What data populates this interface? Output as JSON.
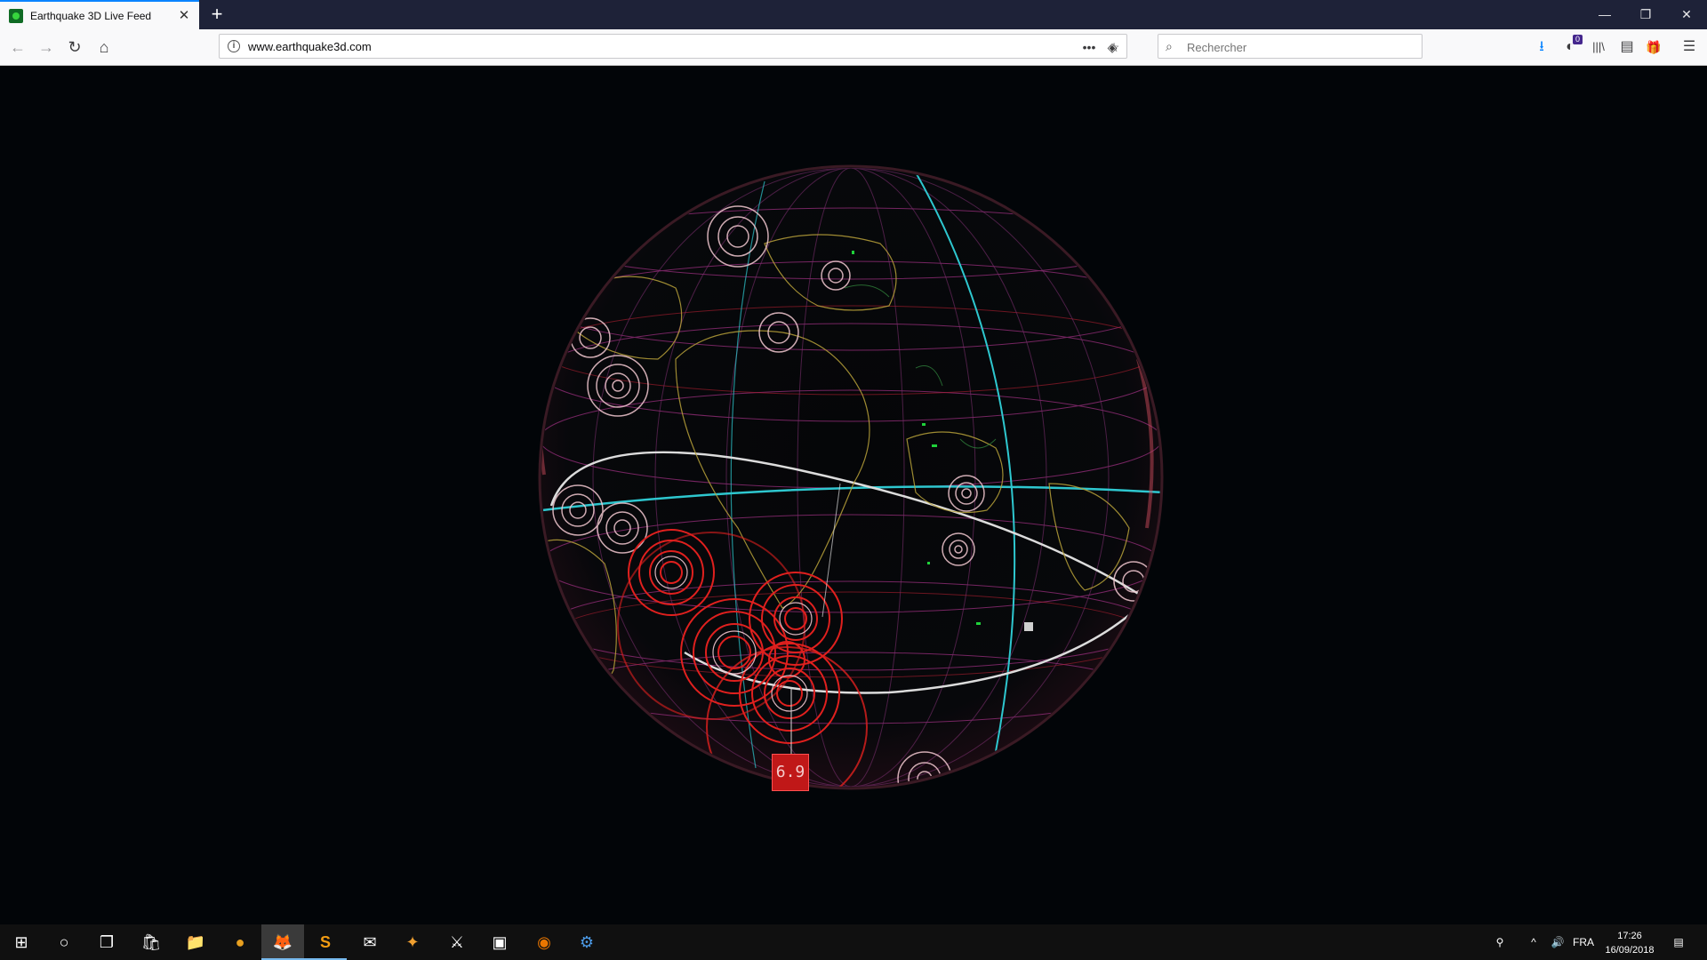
{
  "browser": {
    "tab": {
      "title": "Earthquake 3D Live Feed",
      "favicon": "earth-icon",
      "close_glyph": "✕"
    },
    "new_tab_glyph": "+",
    "window_controls": {
      "minimize": "—",
      "restore": "❐",
      "close": "✕"
    },
    "nav": {
      "back": "←",
      "forward": "→",
      "reload": "↻",
      "home": "⌂"
    },
    "address": {
      "url": "www.earthquake3d.com",
      "info_glyph": "i",
      "page_actions": "•••",
      "pocket": "◈",
      "bookmark": "☆"
    },
    "search": {
      "placeholder": "Rechercher",
      "icon": "⌕"
    },
    "toolbar": {
      "download": "⭳",
      "extension_badge": "0",
      "extension": "◐",
      "library": "|||\\",
      "sidebar": "▤",
      "gift": "🎁",
      "menu": "☰"
    }
  },
  "viewer": {
    "magnitude_label": "6.9",
    "colors": {
      "background": "#020508",
      "quake_ring_major": "#e0201e",
      "quake_ring_minor": "#f2c8d0",
      "grid_cyan": "#2ec7cf",
      "grid_magenta": "#9a2f7e",
      "coast": "#b9a23a"
    }
  },
  "taskbar": {
    "start": "⊞",
    "cortana": "○",
    "task_view": "❐",
    "apps": [
      {
        "name": "store-icon",
        "glyph": "🛍"
      },
      {
        "name": "file-explorer-icon",
        "glyph": "📁"
      },
      {
        "name": "app-icon",
        "glyph": "●"
      },
      {
        "name": "firefox-icon",
        "glyph": "🦊"
      },
      {
        "name": "sublime-text-icon",
        "glyph": "S"
      },
      {
        "name": "mail-icon",
        "glyph": "✉"
      },
      {
        "name": "game-icon",
        "glyph": "✦"
      },
      {
        "name": "skyrim-icon",
        "glyph": "⚔"
      },
      {
        "name": "terminal-icon",
        "glyph": "▣"
      },
      {
        "name": "blender-icon",
        "glyph": "◉"
      },
      {
        "name": "steam-icon",
        "glyph": "⚙"
      }
    ],
    "tray": {
      "people": "⚲",
      "chevron": "^",
      "volume": "🔊",
      "language": "FRA"
    },
    "clock": {
      "time": "17:26",
      "date": "16/09/2018"
    },
    "notifications": "▤"
  }
}
